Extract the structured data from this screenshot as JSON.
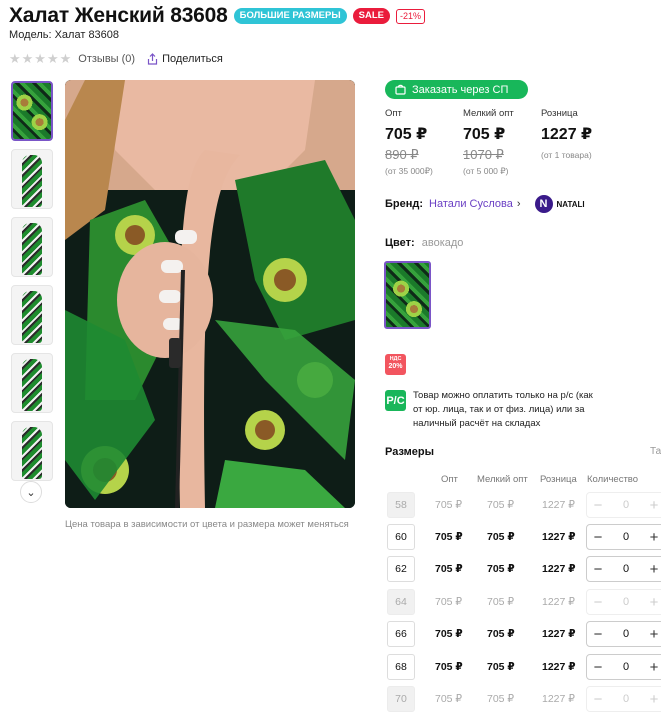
{
  "product": {
    "title": "Халат Женский 83608",
    "badges": {
      "sizes": "БОЛЬШИЕ РАЗМЕРЫ",
      "sale": "SALE",
      "discount": "-21%"
    },
    "model": "Модель: Халат 83608",
    "reviews": "Отзывы (0)",
    "share": "Поделиться",
    "price_note": "Цена товара в зависимости от цвета и размера может меняться"
  },
  "order_button": "Заказать через СП",
  "prices": [
    {
      "label": "Опт",
      "value": "705 ₽",
      "old": "890 ₽",
      "cond": "(от 35 000₽)"
    },
    {
      "label": "Мелкий опт",
      "value": "705 ₽",
      "old": "1070 ₽",
      "cond": "(от 5 000 ₽)"
    },
    {
      "label": "Розница",
      "value": "1227 ₽",
      "old": "",
      "cond": "(от 1 товара)"
    }
  ],
  "brand": {
    "label": "Бренд:",
    "name": "Натали Суслова",
    "logo_letter": "N",
    "logo_text": "NATALI"
  },
  "color": {
    "label": "Цвет:",
    "value": "авокадо"
  },
  "nds": {
    "line1": "НДС",
    "line2": "20%"
  },
  "payment": {
    "icon": "Р/С",
    "text": "Товар можно оплатить только на р/с (как от юр. лица, так и от физ. лица) или за наличный расчёт на складах"
  },
  "sizes": {
    "title": "Размеры",
    "link": "Таб",
    "headers": {
      "opt": "Опт",
      "small": "Мелкий опт",
      "retail": "Розница",
      "qty": "Количество"
    },
    "rows": [
      {
        "size": "58",
        "opt": "705 ₽",
        "small": "705 ₽",
        "retail": "1227 ₽",
        "qty": "0"
      },
      {
        "size": "60",
        "opt": "705 ₽",
        "small": "705 ₽",
        "retail": "1227 ₽",
        "qty": "0"
      },
      {
        "size": "62",
        "opt": "705 ₽",
        "small": "705 ₽",
        "retail": "1227 ₽",
        "qty": "0"
      },
      {
        "size": "64",
        "opt": "705 ₽",
        "small": "705 ₽",
        "retail": "1227 ₽",
        "qty": "0"
      },
      {
        "size": "66",
        "opt": "705 ₽",
        "small": "705 ₽",
        "retail": "1227 ₽",
        "qty": "0"
      },
      {
        "size": "68",
        "opt": "705 ₽",
        "small": "705 ₽",
        "retail": "1227 ₽",
        "qty": "0"
      },
      {
        "size": "70",
        "opt": "705 ₽",
        "small": "705 ₽",
        "retail": "1227 ₽",
        "qty": "0"
      }
    ]
  },
  "colors": {
    "accent": "#7a55c7",
    "green": "#18b75a",
    "sale": "#ea1c3c",
    "badge_sizes": "#2fc4d6"
  }
}
